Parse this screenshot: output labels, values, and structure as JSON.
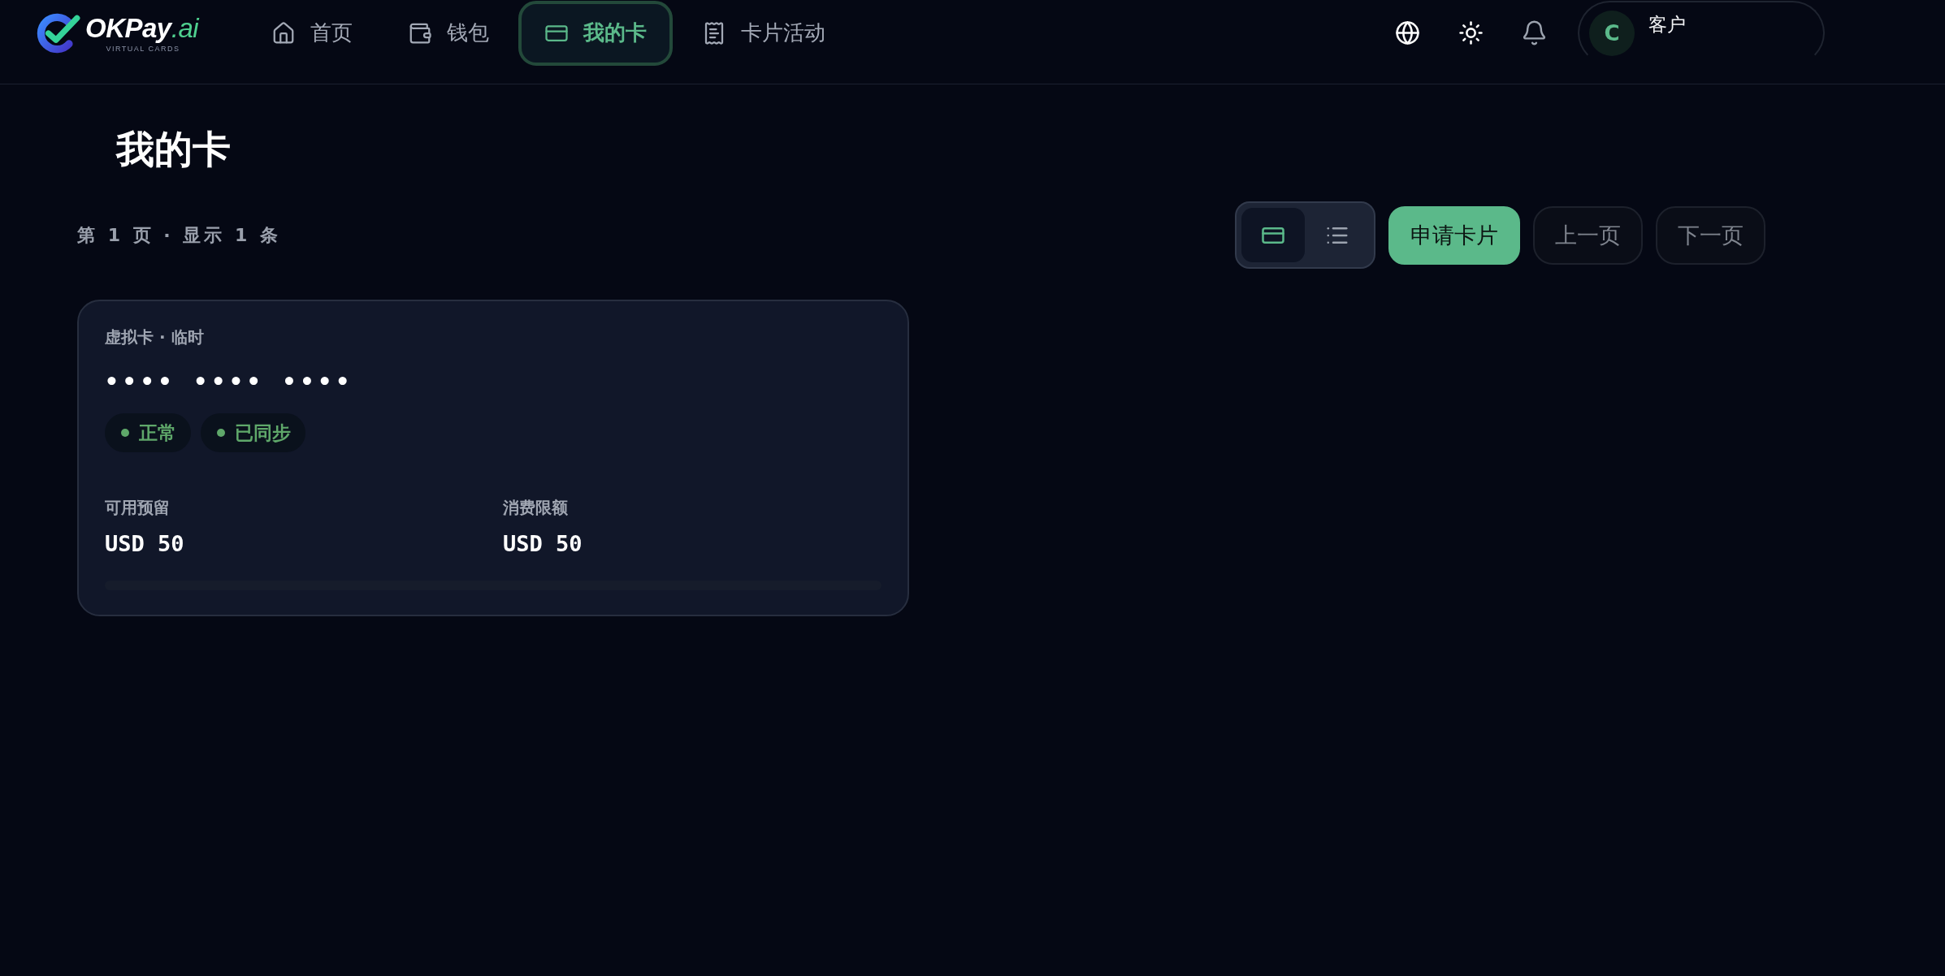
{
  "header": {
    "logo": {
      "text": "OKPay",
      "suffix": ".ai",
      "tagline": "VIRTUAL CARDS"
    },
    "nav": [
      {
        "label": "首页",
        "selected": false
      },
      {
        "label": "钱包",
        "selected": false
      },
      {
        "label": "我的卡",
        "selected": true
      },
      {
        "label": "卡片活动",
        "selected": false
      }
    ],
    "user": {
      "avatar_letter": "C",
      "name": "客户"
    }
  },
  "page": {
    "title": "我的卡",
    "page_info": "第 1 页 · 显示 1 条"
  },
  "view_toggle": [
    {
      "kind": "card",
      "selected": true
    },
    {
      "kind": "list",
      "selected": false
    }
  ],
  "buttons": [
    {
      "label": "申请卡片",
      "kind": "primary",
      "disabled": false
    },
    {
      "label": "上一页",
      "kind": "secondary",
      "disabled": true
    },
    {
      "label": "下一页",
      "kind": "secondary",
      "disabled": true
    }
  ],
  "cards": [
    {
      "type_label": "虚拟卡 · 临时",
      "number": "•••• •••• ••••",
      "status_badges": [
        "正常",
        "已同步"
      ],
      "fields": [
        {
          "label": "可用预留",
          "value": "USD 50"
        },
        {
          "label": "消费限额",
          "value": "USD 50"
        }
      ],
      "usage": {
        "level": 0
      }
    }
  ]
}
